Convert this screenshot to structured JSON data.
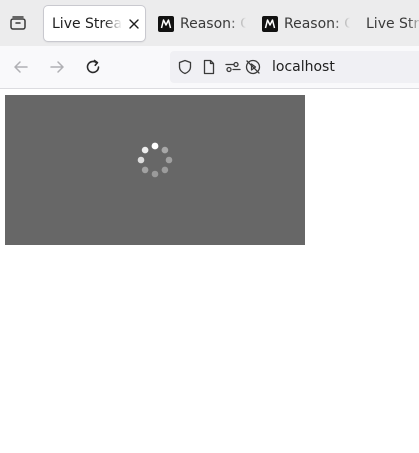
{
  "tabs": [
    {
      "label": "Live Stream",
      "active": true,
      "closable": true
    },
    {
      "label": "Reason: Cl",
      "favicon": "m-logo-icon"
    },
    {
      "label": "Reason: Co",
      "favicon": "m-logo-icon"
    },
    {
      "label": "Live Strea"
    }
  ],
  "navbar": {
    "back_icon": "arrow-left-icon",
    "forward_icon": "arrow-right-icon",
    "reload_icon": "reload-icon",
    "url": "localhost"
  },
  "player": {
    "state": "loading",
    "background": "#676767"
  },
  "colors": {
    "tabbar_bg": "#ececed",
    "navbar_bg": "#f9f9fb",
    "urlbar_bg": "#f0f0f4"
  }
}
